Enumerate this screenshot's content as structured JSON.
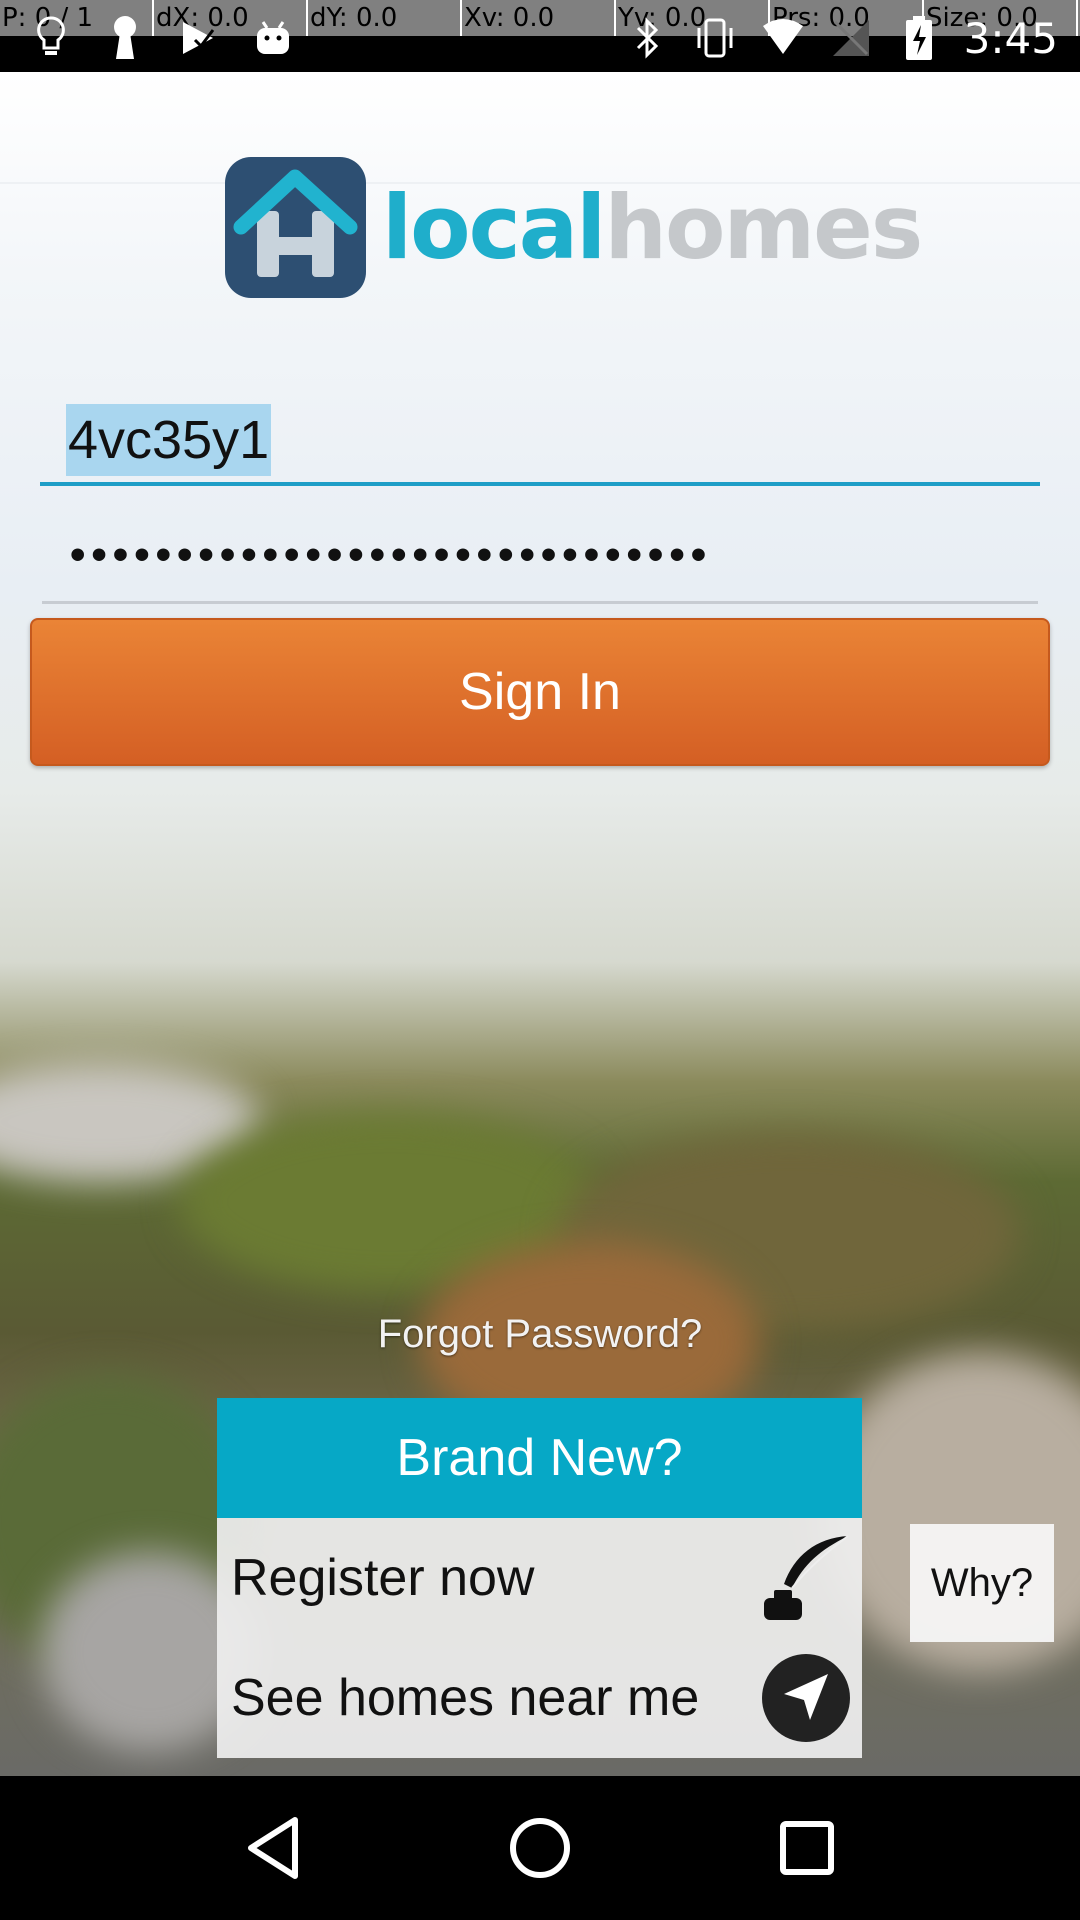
{
  "status_bar": {
    "debug": [
      "P: 0 / 1",
      "dX: 0.0",
      "dY: 0.0",
      "Xv: 0.0",
      "Yv: 0.0",
      "Prs: 0.0",
      "Size: 0.0"
    ],
    "time": "3:45",
    "left_icons": [
      "lightbulb-icon",
      "keyhole-icon",
      "play-store-icon",
      "android-icon"
    ],
    "right_icons": [
      "bluetooth-icon",
      "vibrate-icon",
      "wifi-icon",
      "no-signal-icon",
      "battery-charging-icon"
    ]
  },
  "logo": {
    "word_local": "local",
    "word_homes": "homes"
  },
  "login": {
    "username_value": "4vc35y1",
    "password_value": "••••••••••••••••••••••••••••••",
    "signin_label": "Sign In",
    "forgot_label": "Forgot Password?"
  },
  "brand_new": {
    "header": "Brand New?",
    "register_label": "Register now",
    "near_label": "See homes near me",
    "why_label": "Why?"
  },
  "colors": {
    "accent_teal": "#06a8c6",
    "signin_orange": "#e07333",
    "input_underline": "#1e9ec7"
  },
  "nav": [
    "back-icon",
    "home-icon",
    "recents-icon"
  ]
}
